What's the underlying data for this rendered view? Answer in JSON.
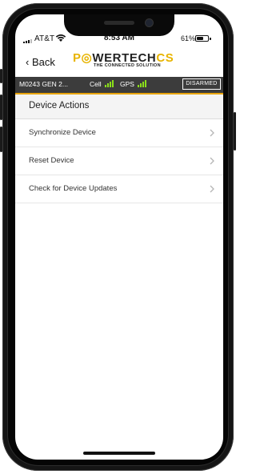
{
  "status_bar": {
    "carrier": "AT&T",
    "time": "8:53 AM",
    "battery_percent": "61%",
    "battery_level": 0.61,
    "icons": [
      "signal-icon",
      "wifi-icon",
      "battery-icon"
    ]
  },
  "nav": {
    "back_label": "Back",
    "back_icon": "chevron-left-icon",
    "logo_text_a": "P",
    "logo_text_b": "WERTECH",
    "logo_text_c": "CS",
    "logo_tagline": "THE CONNECTED SOLUTION",
    "brand_color": "#e8b400"
  },
  "device_bar": {
    "device_name": "M0243 GEN 2...",
    "cell_label": "Cell",
    "gps_label": "GPS",
    "armed_status": "DISARMED",
    "signal_color": "#8be01a",
    "accent_color": "#e8a400"
  },
  "section": {
    "title": "Device Actions"
  },
  "actions": [
    {
      "label": "Synchronize Device",
      "icon": "chevron-right-icon"
    },
    {
      "label": "Reset Device",
      "icon": "chevron-right-icon"
    },
    {
      "label": "Check for Device Updates",
      "icon": "chevron-right-icon"
    }
  ]
}
